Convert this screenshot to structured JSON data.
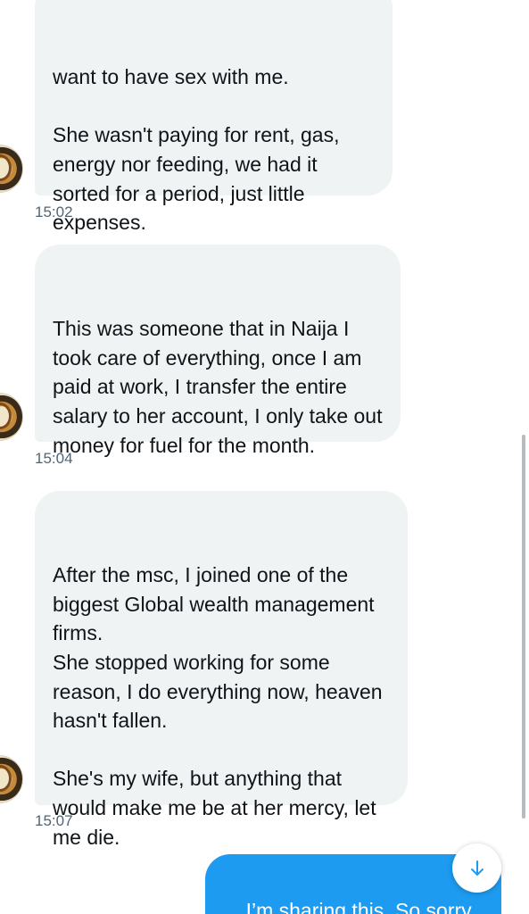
{
  "messages": [
    {
      "text": "want to have sex with me.\n\nShe wasn't paying for rent, gas, energy nor feeding, we had it sorted for a period, just little expenses.",
      "time": "15:02"
    },
    {
      "text": "This was someone that in Naija I took care of everything, once I am paid at work, I transfer the entire salary to her account, I only take out money for fuel for the month.",
      "time": "15:04"
    },
    {
      "text": "After the msc, I joined one of the biggest Global wealth management firms.\nShe stopped working for some reason, I do everything now, heaven hasn't fallen.\n\nShe's my wife, but anything that would make me be at her mercy, let me die.",
      "time": "15:07"
    }
  ],
  "sent": {
    "text": "I’m sharing this. So sorry.\nUnbelievable"
  },
  "icons": {
    "scroll_down": "arrow-down-icon"
  },
  "colors": {
    "received_bubble": "#eff3f4",
    "sent_bubble": "#1d9bf0",
    "accent": "#1d9bf0",
    "timestamp": "#536471"
  }
}
